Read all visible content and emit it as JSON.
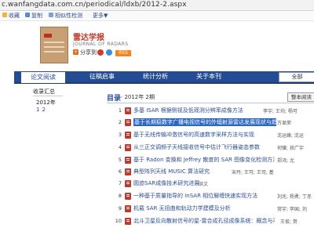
{
  "browser": {
    "url": "c.wanfangdata.com.cn/periodical/ldxb/2012-2.aspx"
  },
  "toolbar": {
    "items": [
      "收藏",
      "复制",
      "相似性检测",
      "更多▼"
    ]
  },
  "journal": {
    "title": "雷达学报",
    "subtitle": "JOURNAL OF RADARS",
    "share_label": "分享到",
    "rss_label": "RSS"
  },
  "tabs": [
    {
      "label": "论文阅读",
      "active": true
    },
    {
      "label": "征稿启事",
      "active": false
    },
    {
      "label": "统计分析",
      "active": false
    },
    {
      "label": "关于本刊",
      "active": false
    }
  ],
  "search_scope": "全部",
  "sidebar": {
    "title": "收录汇总",
    "year": "2012年",
    "issues": [
      "1",
      "2"
    ]
  },
  "toc": {
    "label": "目录",
    "issue_text": "· 2012年 2期",
    "fulltext_button": "整本阅读",
    "articles": [
      {
        "num": "1",
        "title": "多基 ISAR 根据侧视及低观测分辨率成像方法",
        "authors": "李宇; 王均; 杨可",
        "highlight": false
      },
      {
        "num": "2",
        "title": "基于长期稳数字广播电视信号的外辐射源雷达发展现状与趋势",
        "authors": "万显荣",
        "highlight": true
      },
      {
        "num": "3",
        "title": "基于无线传输冲激信号的高速数字采样方法与实现",
        "authors": "沈运峰; 沈运",
        "highlight": false
      },
      {
        "num": "4",
        "title": "从三正交调频子天线接收信号中估计飞行器姿态参数",
        "authors": "何骥; 孩广宇",
        "highlight": false
      },
      {
        "num": "5",
        "title": "基于 Radon 变换和 Jeffrey 散度的 SAR 图像变化检测方法",
        "authors": "郑鸿; 尤",
        "highlight": false
      },
      {
        "num": "6",
        "title": "典型阵列天线 MUSIC 算法研究",
        "authors": "宋丹; 王可; 王司, 基",
        "highlight": false
      },
      {
        "num": "7",
        "title": "圆迹SAR成像技术研究进展",
        "authors": "洪文",
        "highlight": false
      },
      {
        "num": "8",
        "title": "一种基于质量指导的 InSAR 相位解缠快速实现方法",
        "authors": "刘兆; 杨勇; 丁赤",
        "highlight": false
      },
      {
        "num": "9",
        "title": "机载 SAR 无扭曲和轨动力学建模及分析",
        "authors": "常宇; 李国; 刘",
        "highlight": false
      },
      {
        "num": "10",
        "title": "北斗卫星反向散射信号的星-雷合成孔径成像系统：概念与可行性",
        "authors": "王俊; 贺",
        "highlight": false
      }
    ]
  },
  "colors": {
    "nav_blue": "#244c93",
    "link_blue": "#2d4d91",
    "pdf_red": "#c0392b",
    "highlight_blue": "#2a66c9",
    "journal_red": "#c0392b"
  }
}
